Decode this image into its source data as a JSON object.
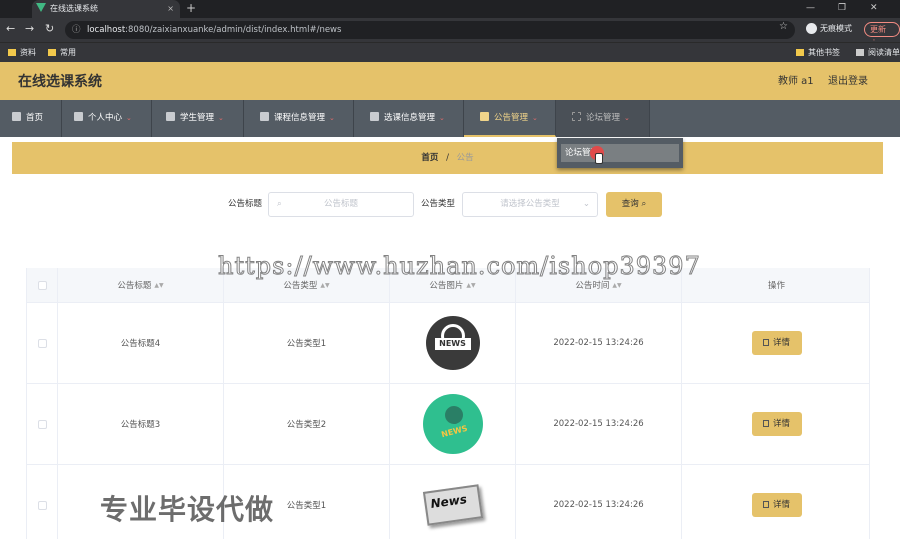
{
  "browser": {
    "tab_title": "在线选课系统",
    "url_host": "localhost",
    "url_rest": ":8080/zaixianxuanke/admin/dist/index.html#/news",
    "incognito_label": "无痕模式",
    "update_label": "更新",
    "bookmarks": [
      "资料",
      "常用"
    ],
    "bookmarks_right": [
      "其他书签",
      "阅读清单"
    ]
  },
  "header": {
    "title": "在线选课系统",
    "user": "教师 a1",
    "logout": "退出登录"
  },
  "nav": {
    "items": [
      {
        "label": "首页"
      },
      {
        "label": "个人中心"
      },
      {
        "label": "学生管理"
      },
      {
        "label": "课程信息管理"
      },
      {
        "label": "选课信息管理"
      },
      {
        "label": "公告管理"
      },
      {
        "label": "论坛管理"
      }
    ],
    "dropdown_item": "论坛管理"
  },
  "breadcrumb": {
    "home": "首页",
    "sep": "/",
    "current": "公告"
  },
  "search": {
    "title_label": "公告标题",
    "title_placeholder": "公告标题",
    "type_label": "公告类型",
    "type_placeholder": "请选择公告类型",
    "query_button": "查询"
  },
  "table": {
    "columns": [
      "公告标题",
      "公告类型",
      "公告图片",
      "公告时间",
      "操作"
    ],
    "detail_label": "详情",
    "rows": [
      {
        "title": "公告标题4",
        "type": "公告类型1",
        "image": "news-globe-icon",
        "time": "2022-02-15 13:24:26"
      },
      {
        "title": "公告标题3",
        "type": "公告类型2",
        "image": "news-mic-icon",
        "time": "2022-02-15 13:24:26"
      },
      {
        "title": "",
        "type": "公告类型1",
        "image": "news-paper-icon",
        "time": "2022-02-15 13:24:26"
      }
    ]
  },
  "watermarks": {
    "url_text": "https://www.huzhan.com/ishop39397",
    "cn_text": "专业毕设代做"
  },
  "colors": {
    "accent": "#e5c26a",
    "nav_bg": "#545c64"
  }
}
